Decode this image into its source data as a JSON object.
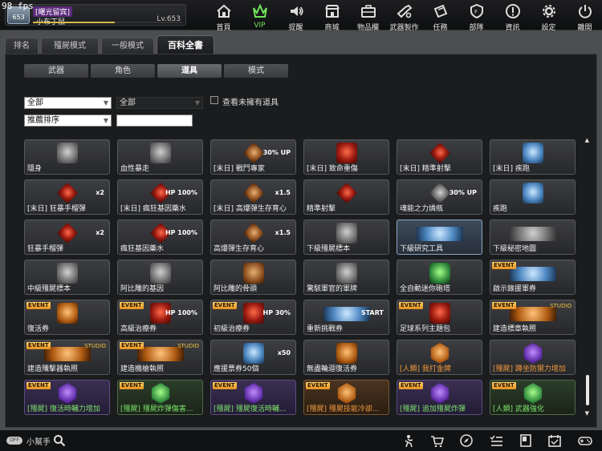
{
  "fps": "98 fps",
  "player": {
    "clan": "[曙光留宾]",
    "name": "小布丁鼠",
    "level": "Lv.653",
    "rank_badge": "653",
    "exp_progress": 0.55
  },
  "nav": [
    {
      "label": "首頁",
      "icon": "home-icon"
    },
    {
      "label": "VIP",
      "icon": "crown-icon"
    },
    {
      "label": "提醒",
      "icon": "speaker-icon"
    },
    {
      "label": "商城",
      "icon": "shop-icon"
    },
    {
      "label": "物品欄",
      "icon": "briefcase-icon"
    },
    {
      "label": "武器製作",
      "icon": "weapon-craft-icon"
    },
    {
      "label": "任務",
      "icon": "ticket-icon"
    },
    {
      "label": "部隊",
      "icon": "shield-icon"
    },
    {
      "label": "資訊",
      "icon": "info-icon"
    },
    {
      "label": "設定",
      "icon": "gear-icon"
    },
    {
      "label": "離開",
      "icon": "power-icon"
    }
  ],
  "tabs": [
    "排名",
    "殭屍模式",
    "一般模式",
    "百科全書"
  ],
  "subtabs": [
    "武器",
    "角色",
    "道具",
    "模式"
  ],
  "filters": {
    "category": "全部",
    "subcategory": "全部",
    "sort": "推薦排序",
    "search_value": "",
    "show_unowned_label": "查看未擁有道具"
  },
  "items": [
    {
      "label": "隱身",
      "icon": "ghost-icon",
      "color": "grey"
    },
    {
      "label": "血性暴走",
      "icon": "boot-icon",
      "color": "grey"
    },
    {
      "label": "[末日] 戰鬥專家",
      "icon": "skill-icon",
      "color": "brown",
      "badge": "30% UP"
    },
    {
      "label": "[末日] 致命重傷",
      "icon": "bullet-icon",
      "color": "red"
    },
    {
      "label": "[末日] 精準射擊",
      "icon": "skull-icon",
      "color": "red"
    },
    {
      "label": "[末日] 疾跑",
      "icon": "boot-icon",
      "color": "blue"
    },
    {
      "label": "[末日] 狂暴手榴彈",
      "icon": "grenade-icon",
      "color": "red",
      "badge": "x2"
    },
    {
      "label": "[末日] 瘋狂基因藥水",
      "icon": "potion-icon",
      "color": "red",
      "badge": "HP 100%"
    },
    {
      "label": "[末日] 高爆彈生存育心",
      "icon": "rank-icon",
      "color": "brown",
      "badge": "x1.5"
    },
    {
      "label": "精準射擊",
      "icon": "skull-icon",
      "color": "red"
    },
    {
      "label": "魂能之力燐瓶",
      "icon": "skill-icon",
      "color": "grey",
      "badge": "30% UP"
    },
    {
      "label": "疾跑",
      "icon": "boot-icon",
      "color": "blue"
    },
    {
      "label": "狂暴手榴彈",
      "icon": "grenade-icon",
      "color": "red",
      "badge": "x2"
    },
    {
      "label": "瘋狂基因藥水",
      "icon": "potion-icon",
      "color": "red",
      "badge": "HP 100%"
    },
    {
      "label": "高爆彈生存育心",
      "icon": "rank-icon",
      "color": "brown",
      "badge": "x1.5"
    },
    {
      "label": "下級殭屍標本",
      "icon": "specimen-icon",
      "color": "grey"
    },
    {
      "label": "下級研究工具",
      "icon": "tool-icon",
      "color": "blue",
      "selected": true
    },
    {
      "label": "下級秘密地圖",
      "icon": "map-icon",
      "color": "grey"
    },
    {
      "label": "中級殭屍標本",
      "icon": "specimen-icon",
      "color": "grey"
    },
    {
      "label": "阿比雕的基因",
      "icon": "vial-icon",
      "color": "grey"
    },
    {
      "label": "阿比雕的骨頭",
      "icon": "bone-icon",
      "color": "brown"
    },
    {
      "label": "驚駭軍官的軍牌",
      "icon": "dogtag-icon",
      "color": "grey"
    },
    {
      "label": "全自動迷你砲塔",
      "icon": "turret-icon",
      "color": "green"
    },
    {
      "label": "啟示錄援軍券",
      "icon": "coupon-icon",
      "color": "blue",
      "event": true
    },
    {
      "label": "復活券",
      "icon": "revive-icon",
      "color": "orange",
      "event": true
    },
    {
      "label": "高級治療券",
      "icon": "medkit-icon",
      "color": "red",
      "badge": "HP 100%",
      "event": true
    },
    {
      "label": "初級治療券",
      "icon": "medkit-icon",
      "color": "red",
      "badge": "HP 30%",
      "event": true
    },
    {
      "label": "重新挑戰券",
      "icon": "start-icon",
      "color": "blue",
      "badge": "START"
    },
    {
      "label": "足球系列主題包",
      "icon": "ball-icon",
      "color": "red",
      "event": true
    },
    {
      "label": "建造標章執照",
      "icon": "license-icon",
      "color": "orange",
      "event": true,
      "studio": true
    },
    {
      "label": "建造殲擊器執照",
      "icon": "license-icon",
      "color": "orange",
      "event": true,
      "studio": true
    },
    {
      "label": "建造機槍執照",
      "icon": "license-icon",
      "color": "orange",
      "event": true,
      "studio": true
    },
    {
      "label": "應援票券50個",
      "icon": "ticket-pack-icon",
      "color": "blue",
      "badge": "x50"
    },
    {
      "label": "無盡輪迴復活券",
      "icon": "hourglass-icon",
      "color": "orange"
    },
    {
      "label": "[人類] 我打金牌",
      "icon": "human-hex-icon",
      "color": "orange",
      "text_color": "orange"
    },
    {
      "label": "[殭屍] 蹲坐防禦力增加",
      "icon": "zombie-hex-icon",
      "color": "purple",
      "text_color": "orange"
    },
    {
      "label": "[殭屍] 復活時輔力增加",
      "icon": "zombie-hex-icon",
      "color": "purple",
      "text_color": "green",
      "event": true,
      "bg": "purple"
    },
    {
      "label": "[殭屍] 殭屍炸彈傷害...",
      "icon": "zombie-hex-icon",
      "color": "green",
      "text_color": "green",
      "event": true,
      "bg": "green"
    },
    {
      "label": "[殭屍] 殭屍復活時輔...",
      "icon": "zombie-hex-icon",
      "color": "purple",
      "text_color": "green",
      "event": true,
      "bg": "purple"
    },
    {
      "label": "[殭屍] 殭屍技能冷卻...",
      "icon": "zombie-hex-icon",
      "color": "orange",
      "text_color": "orange",
      "event": true,
      "bg": "orange"
    },
    {
      "label": "[殭屍] 追加殭屍炸彈",
      "icon": "zombie-hex-icon",
      "color": "purple",
      "text_color": "green",
      "event": true,
      "bg": "purple"
    },
    {
      "label": "[人類] 武器強化",
      "icon": "human-hex-icon",
      "color": "green",
      "text_color": "green",
      "event": true,
      "bg": "green"
    }
  ],
  "event_label": "EVENT",
  "studio_label": "STUDIO",
  "bottom": {
    "helper_label": "小幫手",
    "toggle_text": "OFF",
    "icons": [
      "run-icon",
      "cart-icon",
      "compass-icon",
      "checklist-icon",
      "bookmark-icon",
      "calendar-icon",
      "controller-icon"
    ]
  }
}
